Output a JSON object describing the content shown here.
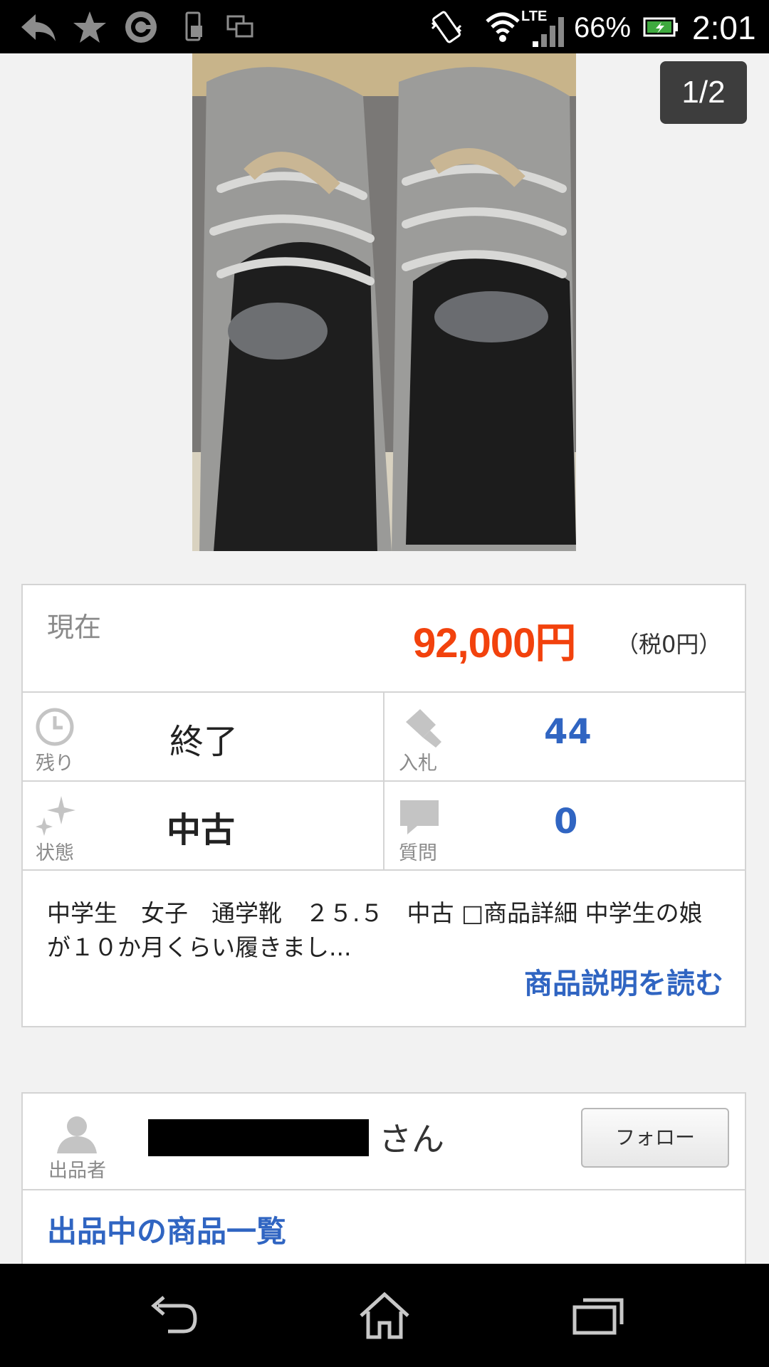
{
  "status_bar": {
    "network": "LTE",
    "battery": "66%",
    "time": "2:01",
    "left_icons": [
      "reply-icon",
      "star-icon",
      "target-app-icon",
      "device-icon",
      "screenshot-icon"
    ],
    "right_icons": [
      "vibrate-icon",
      "wifi-icon",
      "signal-icon",
      "battery-icon"
    ]
  },
  "gallery": {
    "counter": "1/2"
  },
  "auction": {
    "price_label": "現在",
    "price": "92,000円",
    "tax": "（税0円）",
    "time_left_caption": "残り",
    "time_left_value": "終了",
    "bids_caption": "入札",
    "bids_value": "44",
    "condition_caption": "状態",
    "condition_value": "中古",
    "questions_caption": "質問",
    "questions_value": "0",
    "description": "中学生　女子　通学靴　２５.５　中古 □商品詳細 中学生の娘が１０か月くらい履きまし...",
    "read_more": "商品説明を読む"
  },
  "seller": {
    "caption": "出品者",
    "suffix": "さん",
    "follow": "フォロー",
    "listings_link": "出品中の商品一覧"
  },
  "nav_bar": {
    "buttons": [
      "back-icon",
      "home-icon",
      "recent-apps-icon"
    ]
  },
  "colors": {
    "price": "#f2420d",
    "link_blue": "#3065c2",
    "status_bar": "#000000"
  }
}
